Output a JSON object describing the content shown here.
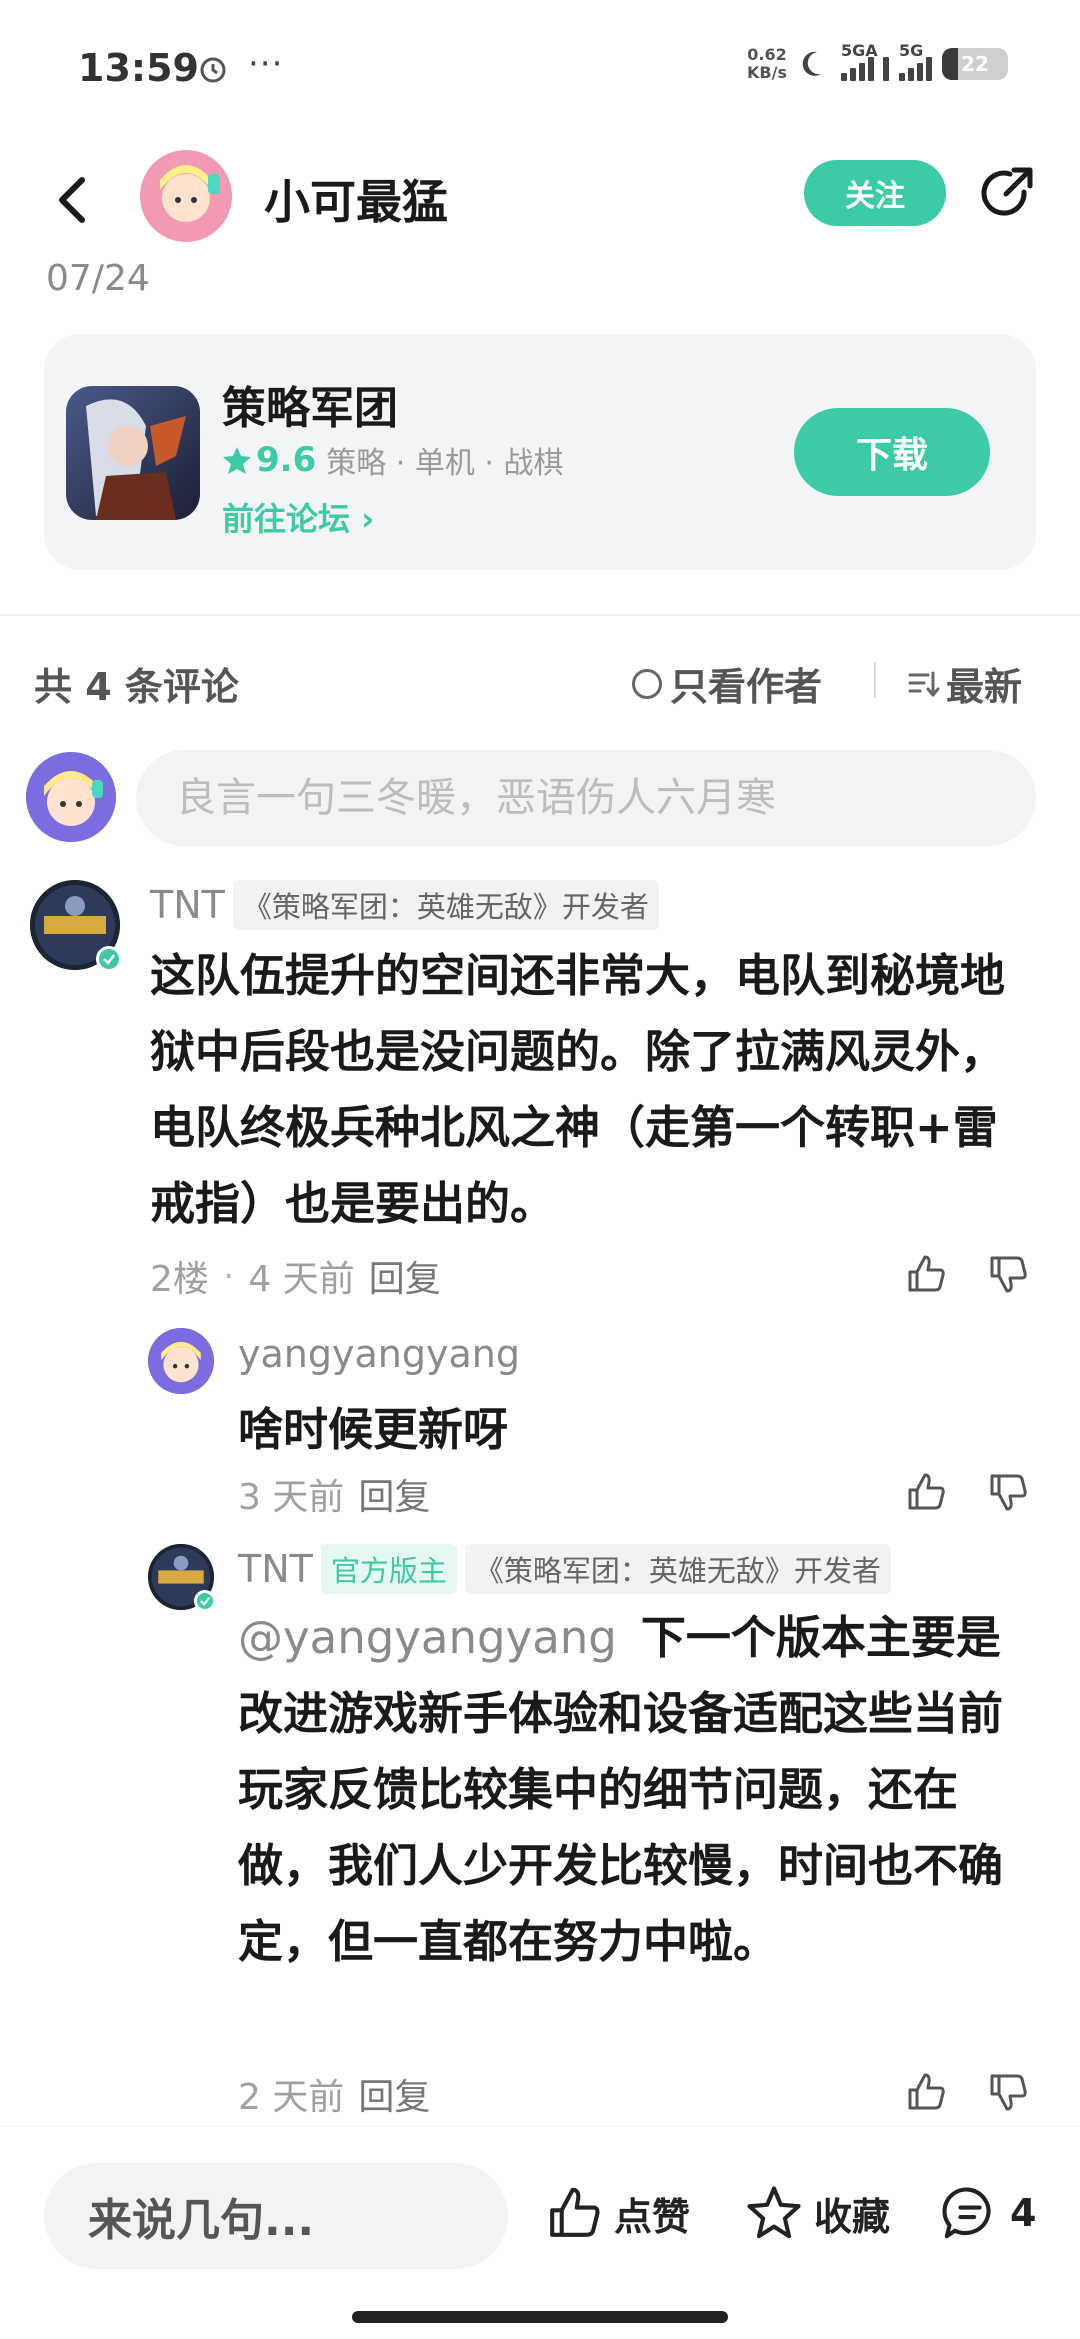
{
  "status_bar": {
    "time": "13:59",
    "dots": "···",
    "net_speed_value": "0.62",
    "net_speed_unit": "KB/s",
    "sig1_label": "5GA",
    "sig2_label": "5G",
    "battery": "22",
    "battery_level": 0.22
  },
  "header": {
    "author_name": "小可最猛",
    "follow_label": "关注"
  },
  "post": {
    "date": "07/24"
  },
  "game_card": {
    "title": "策略军团",
    "rating": "9.6",
    "tags": "策略 · 单机 · 战棋",
    "forum_link": "前往论坛 ›",
    "download_label": "下载"
  },
  "comments_toolbar": {
    "count_label": "共 4 条评论",
    "author_only_label": "只看作者",
    "sort_label": "最新"
  },
  "comment_input": {
    "placeholder": "良言一句三冬暖，恶语伤人六月寒"
  },
  "comments": [
    {
      "name": "TNT",
      "tag": "《策略军团：英雄无敌》开发者",
      "text": "这队伍提升的空间还非常大，电队到秘境地狱中后段也是没问题的。除了拉满风灵外，电队终极兵种北风之神（走第一个转职+雷戒指）也是要出的。",
      "floor": "2楼",
      "time": "4 天前",
      "reply_label": "回复"
    },
    {
      "name": "yangyangyang",
      "text": "啥时候更新呀",
      "time": "3 天前",
      "reply_label": "回复"
    },
    {
      "name": "TNT",
      "mod_tag": "官方版主",
      "tag": "《策略军团：英雄无敌》开发者",
      "mention": "@yangyangyang",
      "text": "下一个版本主要是改进游戏新手体验和设备适配这些当前玩家反馈比较集中的细节问题，还在做，我们人少开发比较慢，时间也不确定，但一直都在努力中啦。",
      "time": "2 天前",
      "reply_label": "回复"
    }
  ],
  "bottom_bar": {
    "say_placeholder": "来说几句...",
    "like_label": "点赞",
    "fav_label": "收藏",
    "comment_count": "4"
  },
  "colors": {
    "accent": "#3ccaa7"
  }
}
